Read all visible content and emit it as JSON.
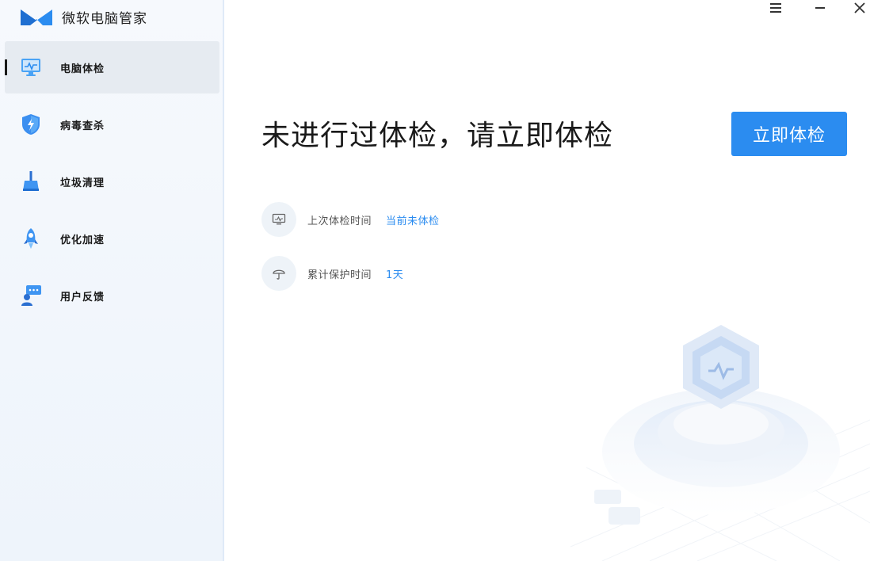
{
  "app": {
    "title": "微软电脑管家"
  },
  "window_controls": {
    "menu_icon": "hamburger-menu-icon",
    "minimize_icon": "minimize-icon",
    "close_icon": "close-icon"
  },
  "sidebar": {
    "items": [
      {
        "label": "电脑体检",
        "icon": "monitor-check-icon",
        "active": true
      },
      {
        "label": "病毒查杀",
        "icon": "shield-lightning-icon",
        "active": false
      },
      {
        "label": "垃圾清理",
        "icon": "broom-icon",
        "active": false
      },
      {
        "label": "优化加速",
        "icon": "rocket-icon",
        "active": false
      },
      {
        "label": "用户反馈",
        "icon": "feedback-user-icon",
        "active": false
      }
    ]
  },
  "main": {
    "headline": "未进行过体检，请立即体检",
    "primary_button": "立即体检",
    "info": [
      {
        "label": "上次体检时间",
        "value": "当前未体检",
        "icon": "monitor-icon"
      },
      {
        "label": "累计保护时间",
        "value": "1天",
        "icon": "umbrella-icon"
      }
    ]
  },
  "colors": {
    "accent": "#2b8cf0",
    "sidebar_bg": "#f3f7fc",
    "active_item_bg": "#e6ebf1"
  }
}
